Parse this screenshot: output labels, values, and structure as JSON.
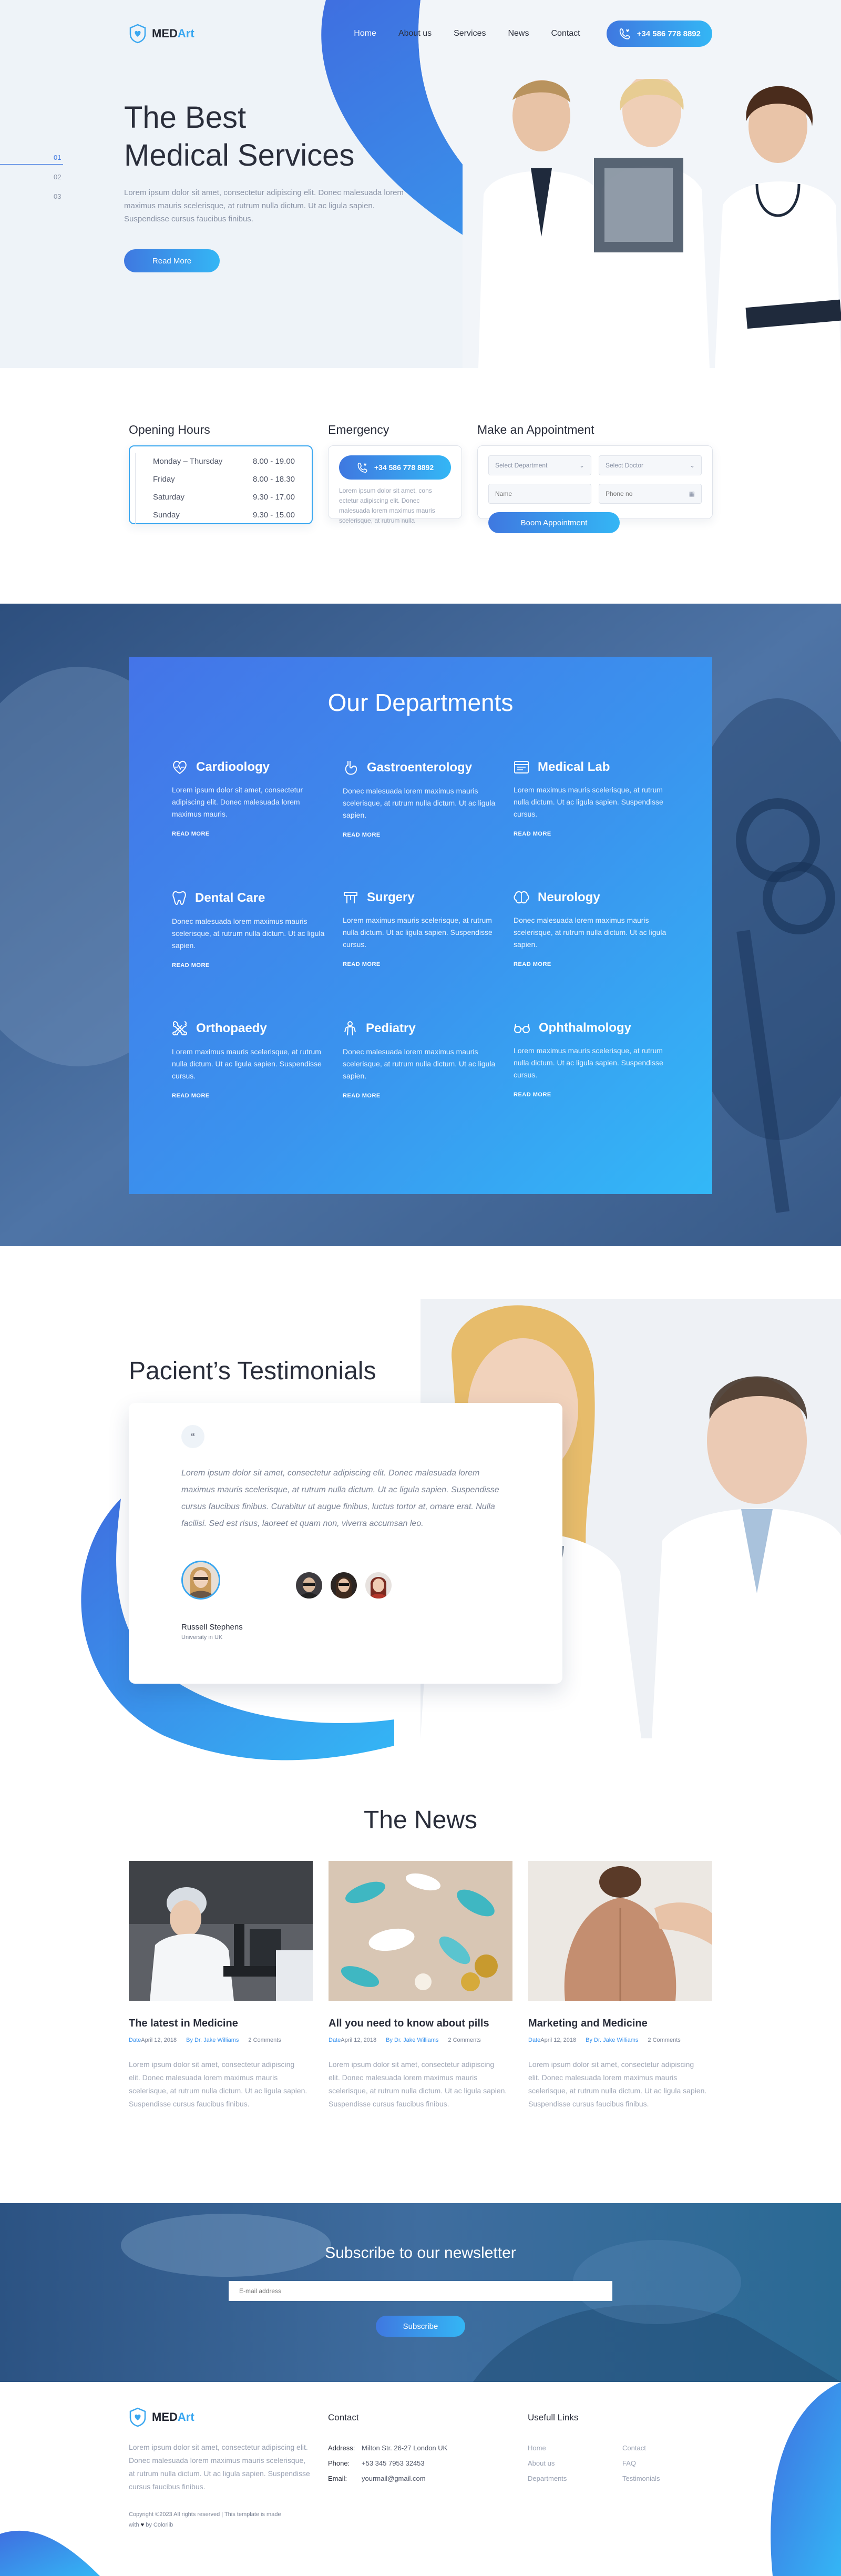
{
  "header": {
    "logo_prefix": "MED",
    "logo_accent": "Art",
    "nav": [
      "Home",
      "About us",
      "Services",
      "News",
      "Contact"
    ],
    "phone": "+34 586 778 8892"
  },
  "hero": {
    "title_line1": "The Best",
    "title_line2": "Medical Services",
    "text": "Lorem ipsum dolor sit amet, consectetur adipiscing elit. Donec malesuada lorem maximus mauris scelerisque, at rutrum nulla dictum. Ut ac ligula sapien. Suspendisse cursus faucibus finibus.",
    "button": "Read More",
    "slides": [
      "01",
      "02",
      "03"
    ]
  },
  "hours": {
    "title": "Opening Hours",
    "rows": [
      {
        "day": "Monday – Thursday",
        "time": "8.00 - 19.00"
      },
      {
        "day": "Friday",
        "time": "8.00 - 18.30"
      },
      {
        "day": "Saturday",
        "time": "9.30 - 17.00"
      },
      {
        "day": "Sunday",
        "time": "9.30 - 15.00"
      }
    ]
  },
  "emergency": {
    "title": "Emergency",
    "phone": "+34 586 778 8892",
    "text": "Lorem ipsum dolor sit amet, cons ectetur adipiscing elit. Donec malesuada lorem maximus mauris scelerisque, at rutrum nulla"
  },
  "appointment": {
    "title": "Make an Appointment",
    "department_placeholder": "Select Department",
    "doctor_placeholder": "Select Doctor",
    "name_placeholder": "Name",
    "phone_placeholder": "Phone no",
    "button": "Boom Appointment"
  },
  "departments": {
    "title": "Our Departments",
    "read_more": "READ MORE",
    "items": [
      {
        "name": "Cardioology",
        "icon": "heart-icon",
        "text": "Lorem ipsum dolor sit amet, consectetur adipiscing elit. Donec malesuada lorem maximus mauris."
      },
      {
        "name": "Gastroenterology",
        "icon": "stomach-icon",
        "text": "Donec malesuada lorem maximus mauris scelerisque, at rutrum nulla dictum. Ut ac ligula sapien."
      },
      {
        "name": "Medical Lab",
        "icon": "lab-icon",
        "text": "Lorem maximus mauris scelerisque, at rutrum nulla dictum. Ut ac ligula sapien. Suspendisse cursus."
      },
      {
        "name": "Dental Care",
        "icon": "tooth-icon",
        "text": "Donec malesuada lorem maximus mauris scelerisque, at rutrum nulla dictum. Ut ac ligula sapien."
      },
      {
        "name": "Surgery",
        "icon": "surgery-icon",
        "text": "Lorem maximus mauris scelerisque, at rutrum nulla dictum. Ut ac ligula sapien. Suspendisse cursus."
      },
      {
        "name": "Neurology",
        "icon": "brain-icon",
        "text": "Donec malesuada lorem maximus mauris scelerisque, at rutrum nulla dictum. Ut ac ligula sapien."
      },
      {
        "name": "Orthopaedy",
        "icon": "bone-icon",
        "text": "Lorem maximus mauris scelerisque, at rutrum nulla dictum. Ut ac ligula sapien. Suspendisse cursus."
      },
      {
        "name": "Pediatry",
        "icon": "child-icon",
        "text": "Donec malesuada lorem maximus mauris scelerisque, at rutrum nulla dictum. Ut ac ligula sapien."
      },
      {
        "name": "Ophthalmology",
        "icon": "glasses-icon",
        "text": "Lorem maximus mauris scelerisque, at rutrum nulla dictum. Ut ac ligula sapien. Suspendisse cursus."
      }
    ]
  },
  "testimonials": {
    "title": "Pacient’s Testimonials",
    "quote": "Lorem ipsum dolor sit amet, consectetur adipiscing elit. Donec malesuada lorem maximus mauris scelerisque, at rutrum nulla dictum. Ut ac ligula sapien. Suspendisse cursus faucibus finibus. Curabitur ut augue finibus, luctus tortor at, ornare erat. Nulla facilisi. Sed est risus, laoreet et quam non, viverra accumsan leo.",
    "author_name": "Russell Stephens",
    "author_role": "University in UK"
  },
  "news": {
    "title": "The News",
    "date_label": "Date",
    "by_label": "By",
    "items": [
      {
        "title": "The latest in Medicine",
        "date": "April 12, 2018",
        "author": "Dr. Jake Williams",
        "comments": "2 Comments",
        "text": "Lorem ipsum dolor sit amet, consectetur adipiscing elit. Donec malesuada lorem maximus mauris scelerisque, at rutrum nulla dictum. Ut ac ligula sapien. Suspendisse cursus faucibus finibus."
      },
      {
        "title": "All you need to know about pills",
        "date": "April 12, 2018",
        "author": "Dr. Jake Williams",
        "comments": "2 Comments",
        "text": "Lorem ipsum dolor sit amet, consectetur adipiscing elit. Donec malesuada lorem maximus mauris scelerisque, at rutrum nulla dictum. Ut ac ligula sapien. Suspendisse cursus faucibus finibus."
      },
      {
        "title": "Marketing and Medicine",
        "date": "April 12, 2018",
        "author": "Dr. Jake Williams",
        "comments": "2 Comments",
        "text": "Lorem ipsum dolor sit amet, consectetur adipiscing elit. Donec malesuada lorem maximus mauris scelerisque, at rutrum nulla dictum. Ut ac ligula sapien. Suspendisse cursus faucibus finibus."
      }
    ]
  },
  "newsletter": {
    "title": "Subscribe to our newsletter",
    "placeholder": "E-mail address",
    "button": "Subscribe"
  },
  "footer": {
    "logo_prefix": "MED",
    "logo_accent": "Art",
    "text": "Lorem ipsum dolor sit amet, consectetur adipiscing elit. Donec malesuada lorem maximus mauris scelerisque, at rutrum nulla dictum. Ut ac ligula sapien. Suspendisse cursus faucibus finibus.",
    "copyright_line1": "Copyright ©2023 All rights reserved | This template is made",
    "copyright_with": "with",
    "copyright_by": "by Colorlib",
    "contact_title": "Contact",
    "contact": [
      {
        "key": "Address:",
        "value": "Milton Str. 26-27 London UK"
      },
      {
        "key": "Phone:",
        "value": "+53 345 7953 32453"
      },
      {
        "key": "Email:",
        "value": "yourmail@gmail.com"
      }
    ],
    "links_title": "Usefull Links",
    "links": [
      "Home",
      "Contact",
      "About us",
      "FAQ",
      "Departments",
      "Testimonials"
    ]
  },
  "colors": {
    "accent_blue": "#3f78e0",
    "accent_cyan": "#34b6f5",
    "text_dark": "#2a2e3b"
  }
}
